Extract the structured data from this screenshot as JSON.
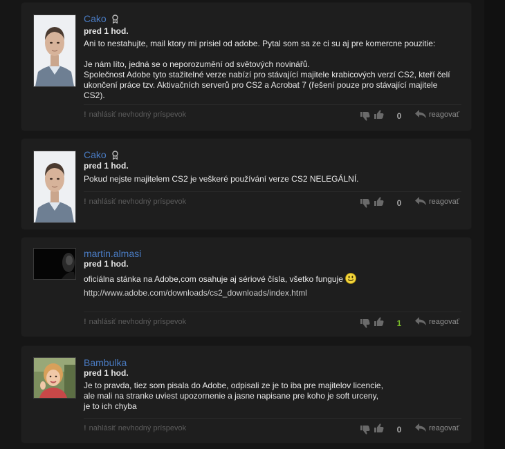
{
  "comments": [
    {
      "author": "Cako",
      "has_badge": true,
      "time": "pred 1 hod.",
      "body": [
        "Ani to nestahujte, mail ktory mi prisiel od adobe. Pytal som sa ze ci su aj pre komercne pouzitie:",
        "",
        "Je nám líto, jedná se o neporozumění od světových novinářů.",
        "Společnost Adobe tyto stažitelné verze nabízí pro stávající majitele krabicových verzí CS2, kteří čelí ukončení práce tzv. Aktivačních serverů pro CS2 a Acrobat 7 (řešení pouze pro stávající majitele CS2)."
      ],
      "report_label": "nahlásiť nevhodný príspevok",
      "score": "0",
      "reply_label": "reagovať",
      "avatar": "man-portrait"
    },
    {
      "author": "Cako",
      "has_badge": true,
      "time": "pred 1 hod.",
      "body": [
        "Pokud nejste majitelem CS2 je veškeré používání verze CS2 NELEGÁLNÍ."
      ],
      "report_label": "nahlásiť nevhodný príspevok",
      "score": "0",
      "reply_label": "reagovať",
      "avatar": "man-portrait"
    },
    {
      "author": "martin.almasi",
      "has_badge": false,
      "time": "pred 1 hod.",
      "body": [
        "oficiálna stánka na Adobe,com osahuje aj sériové čísla, všetko funguje",
        "http://www.adobe.com/downloads/cs2_downloads/index.html"
      ],
      "report_label": "nahlásiť nevhodný príspevok",
      "score": "1",
      "reply_label": "reagovať",
      "avatar": "dark-portrait"
    },
    {
      "author": "Bambulka",
      "has_badge": false,
      "time": "pred 1 hod.",
      "body": [
        "Je to pravda, tiez som pisala do Adobe, odpisali ze je to iba pre majitelov licencie,",
        "ale mali na stranke uviest upozornenie a jasne napisane pre koho je soft urceny,",
        "je to ich chyba"
      ],
      "report_label": "nahlásiť nevhodný príspevok",
      "score": "0",
      "reply_label": "reagovať",
      "avatar": "child-portrait"
    }
  ],
  "colors": {
    "author": "#4a7cc4",
    "positive_score": "#78b82a",
    "neutral_score": "#a8a8a8",
    "background": "#161616",
    "card": "#1e1e1e"
  }
}
